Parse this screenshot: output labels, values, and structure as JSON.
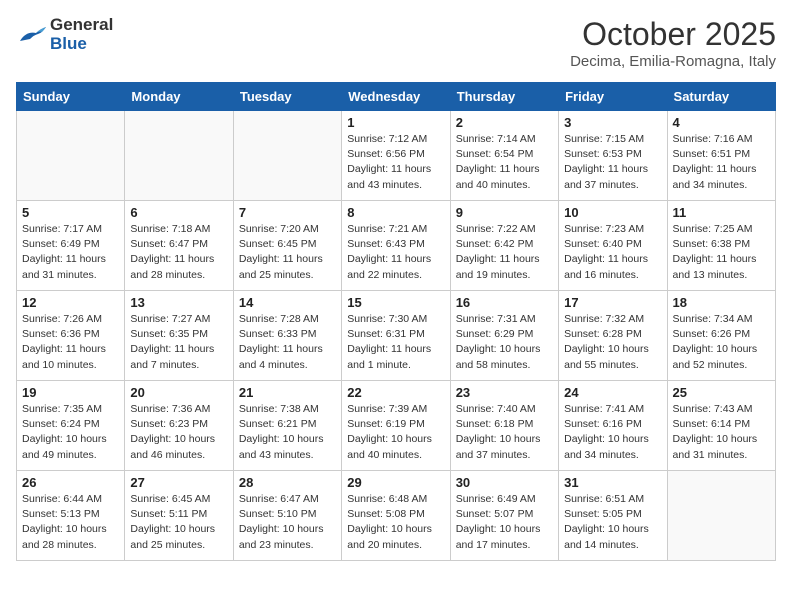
{
  "header": {
    "logo_general": "General",
    "logo_blue": "Blue",
    "month_title": "October 2025",
    "location": "Decima, Emilia-Romagna, Italy"
  },
  "days_of_week": [
    "Sunday",
    "Monday",
    "Tuesday",
    "Wednesday",
    "Thursday",
    "Friday",
    "Saturday"
  ],
  "weeks": [
    [
      {
        "day": "",
        "info": ""
      },
      {
        "day": "",
        "info": ""
      },
      {
        "day": "",
        "info": ""
      },
      {
        "day": "1",
        "info": "Sunrise: 7:12 AM\nSunset: 6:56 PM\nDaylight: 11 hours and 43 minutes."
      },
      {
        "day": "2",
        "info": "Sunrise: 7:14 AM\nSunset: 6:54 PM\nDaylight: 11 hours and 40 minutes."
      },
      {
        "day": "3",
        "info": "Sunrise: 7:15 AM\nSunset: 6:53 PM\nDaylight: 11 hours and 37 minutes."
      },
      {
        "day": "4",
        "info": "Sunrise: 7:16 AM\nSunset: 6:51 PM\nDaylight: 11 hours and 34 minutes."
      }
    ],
    [
      {
        "day": "5",
        "info": "Sunrise: 7:17 AM\nSunset: 6:49 PM\nDaylight: 11 hours and 31 minutes."
      },
      {
        "day": "6",
        "info": "Sunrise: 7:18 AM\nSunset: 6:47 PM\nDaylight: 11 hours and 28 minutes."
      },
      {
        "day": "7",
        "info": "Sunrise: 7:20 AM\nSunset: 6:45 PM\nDaylight: 11 hours and 25 minutes."
      },
      {
        "day": "8",
        "info": "Sunrise: 7:21 AM\nSunset: 6:43 PM\nDaylight: 11 hours and 22 minutes."
      },
      {
        "day": "9",
        "info": "Sunrise: 7:22 AM\nSunset: 6:42 PM\nDaylight: 11 hours and 19 minutes."
      },
      {
        "day": "10",
        "info": "Sunrise: 7:23 AM\nSunset: 6:40 PM\nDaylight: 11 hours and 16 minutes."
      },
      {
        "day": "11",
        "info": "Sunrise: 7:25 AM\nSunset: 6:38 PM\nDaylight: 11 hours and 13 minutes."
      }
    ],
    [
      {
        "day": "12",
        "info": "Sunrise: 7:26 AM\nSunset: 6:36 PM\nDaylight: 11 hours and 10 minutes."
      },
      {
        "day": "13",
        "info": "Sunrise: 7:27 AM\nSunset: 6:35 PM\nDaylight: 11 hours and 7 minutes."
      },
      {
        "day": "14",
        "info": "Sunrise: 7:28 AM\nSunset: 6:33 PM\nDaylight: 11 hours and 4 minutes."
      },
      {
        "day": "15",
        "info": "Sunrise: 7:30 AM\nSunset: 6:31 PM\nDaylight: 11 hours and 1 minute."
      },
      {
        "day": "16",
        "info": "Sunrise: 7:31 AM\nSunset: 6:29 PM\nDaylight: 10 hours and 58 minutes."
      },
      {
        "day": "17",
        "info": "Sunrise: 7:32 AM\nSunset: 6:28 PM\nDaylight: 10 hours and 55 minutes."
      },
      {
        "day": "18",
        "info": "Sunrise: 7:34 AM\nSunset: 6:26 PM\nDaylight: 10 hours and 52 minutes."
      }
    ],
    [
      {
        "day": "19",
        "info": "Sunrise: 7:35 AM\nSunset: 6:24 PM\nDaylight: 10 hours and 49 minutes."
      },
      {
        "day": "20",
        "info": "Sunrise: 7:36 AM\nSunset: 6:23 PM\nDaylight: 10 hours and 46 minutes."
      },
      {
        "day": "21",
        "info": "Sunrise: 7:38 AM\nSunset: 6:21 PM\nDaylight: 10 hours and 43 minutes."
      },
      {
        "day": "22",
        "info": "Sunrise: 7:39 AM\nSunset: 6:19 PM\nDaylight: 10 hours and 40 minutes."
      },
      {
        "day": "23",
        "info": "Sunrise: 7:40 AM\nSunset: 6:18 PM\nDaylight: 10 hours and 37 minutes."
      },
      {
        "day": "24",
        "info": "Sunrise: 7:41 AM\nSunset: 6:16 PM\nDaylight: 10 hours and 34 minutes."
      },
      {
        "day": "25",
        "info": "Sunrise: 7:43 AM\nSunset: 6:14 PM\nDaylight: 10 hours and 31 minutes."
      }
    ],
    [
      {
        "day": "26",
        "info": "Sunrise: 6:44 AM\nSunset: 5:13 PM\nDaylight: 10 hours and 28 minutes."
      },
      {
        "day": "27",
        "info": "Sunrise: 6:45 AM\nSunset: 5:11 PM\nDaylight: 10 hours and 25 minutes."
      },
      {
        "day": "28",
        "info": "Sunrise: 6:47 AM\nSunset: 5:10 PM\nDaylight: 10 hours and 23 minutes."
      },
      {
        "day": "29",
        "info": "Sunrise: 6:48 AM\nSunset: 5:08 PM\nDaylight: 10 hours and 20 minutes."
      },
      {
        "day": "30",
        "info": "Sunrise: 6:49 AM\nSunset: 5:07 PM\nDaylight: 10 hours and 17 minutes."
      },
      {
        "day": "31",
        "info": "Sunrise: 6:51 AM\nSunset: 5:05 PM\nDaylight: 10 hours and 14 minutes."
      },
      {
        "day": "",
        "info": ""
      }
    ]
  ]
}
